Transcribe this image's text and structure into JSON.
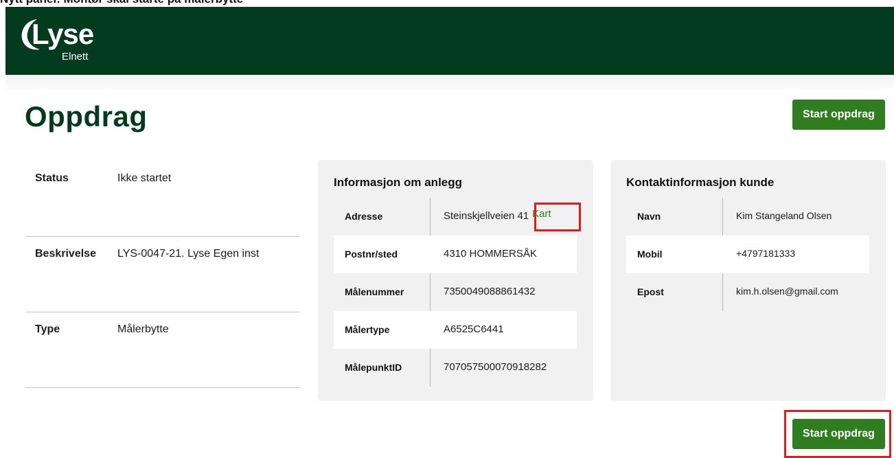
{
  "caption": "Nytt panel: Montør skal starte på målerbytte",
  "brand": {
    "name": "Lyse",
    "sub": "Elnett"
  },
  "page_title": "Oppdrag",
  "start_button": "Start oppdrag",
  "meta": [
    {
      "label": "Status",
      "value": "Ikke startet"
    },
    {
      "label": "Beskrivelse",
      "value": "LYS-0047-21. Lyse Egen inst"
    },
    {
      "label": "Type",
      "value": "Målerbytte"
    }
  ],
  "anlegg": {
    "title": "Informasjon om anlegg",
    "kart_label": "Kart",
    "rows": [
      {
        "label": "Adresse",
        "value": "Steinskjellveien 41"
      },
      {
        "label": "Postnr/sted",
        "value": "4310 HOMMERSÅK"
      },
      {
        "label": "Målenummer",
        "value": "7350049088861432"
      },
      {
        "label": "Målertype",
        "value": "A6525C6441"
      },
      {
        "label": "MålepunktID",
        "value": "707057500070918282"
      }
    ]
  },
  "kunde": {
    "title": "Kontaktinformasjon kunde",
    "rows": [
      {
        "label": "Navn",
        "value": "Kim Stangeland Olsen"
      },
      {
        "label": "Mobil",
        "value": "+4797181333"
      },
      {
        "label": "Epost",
        "value": "kim.h.olsen@gmail.com"
      }
    ]
  },
  "colors": {
    "header": "#023b1d",
    "accent": "#2f7d1f",
    "highlight": "#e01b1b"
  }
}
